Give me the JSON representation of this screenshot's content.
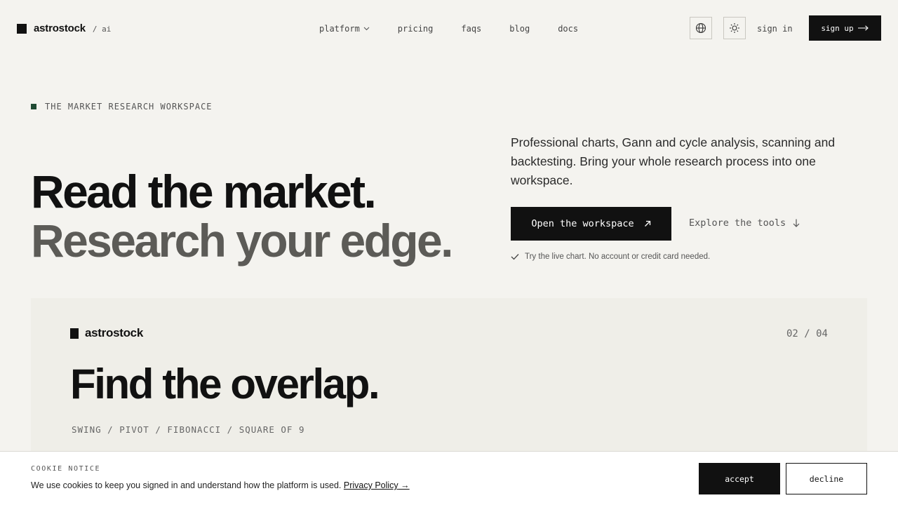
{
  "header": {
    "logo_text": "astrostock",
    "logo_suffix": "/ ai",
    "nav": [
      {
        "label": "platform"
      },
      {
        "label": "pricing"
      },
      {
        "label": "faqs"
      },
      {
        "label": "blog"
      },
      {
        "label": "docs"
      }
    ],
    "signin_label": "sign in",
    "signup_label": "sign up"
  },
  "hero": {
    "eyebrow": "THE MARKET RESEARCH WORKSPACE",
    "headline_line1": "Read the market.",
    "headline_line2": "Research your edge.",
    "lede": "Professional charts, Gann and cycle analysis, scanning and backtesting. Bring your whole research process into one workspace.",
    "cta_primary": "Open the workspace",
    "cta_secondary": "Explore the tools",
    "note": "Try the live chart. No account or credit card needed."
  },
  "showcase": {
    "logo_text": "astrostock",
    "counter": "02 / 04",
    "title": "Find the overlap.",
    "tags": "SWING / PIVOT / FIBONACCI / SQUARE OF 9"
  },
  "cookie": {
    "label": "COOKIE NOTICE",
    "text": "We use cookies to keep you signed in and understand how the platform is used.",
    "link": "Privacy Policy",
    "accept": "accept",
    "decline": "decline"
  },
  "colors": {
    "background": "#f4f3ef",
    "panel": "#efeee8",
    "accent_dot": "#1f4a33",
    "primary": "#111111"
  }
}
